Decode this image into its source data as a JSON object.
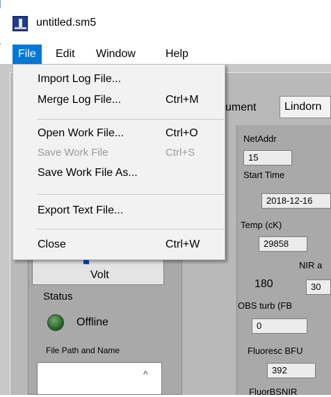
{
  "window": {
    "title": "untitled.sm5"
  },
  "menubar": {
    "items": [
      "File",
      "Edit",
      "Window",
      "Help"
    ]
  },
  "file_menu": {
    "items": [
      {
        "label": "Import Log File...",
        "shortcut": "",
        "enabled": true
      },
      {
        "label": "Merge Log File...",
        "shortcut": "Ctrl+M",
        "enabled": true
      },
      {
        "label": "Open Work File...",
        "shortcut": "Ctrl+O",
        "enabled": true
      },
      {
        "label": "Save Work File",
        "shortcut": "Ctrl+S",
        "enabled": false
      },
      {
        "label": "Save Work File As...",
        "shortcut": "",
        "enabled": true
      },
      {
        "label": "Export Text File...",
        "shortcut": "",
        "enabled": true
      },
      {
        "label": "Close",
        "shortcut": "Ctrl+W",
        "enabled": true
      }
    ]
  },
  "panel": {
    "instrument_label": "ument",
    "instrument_value": "Lindorn",
    "gauge_label": "Volt",
    "status_label": "Status",
    "status_value": "Offline",
    "file_path_label": "File Path and Name"
  },
  "fields": {
    "netaddr_label": "NetAddr",
    "netaddr_value": "15",
    "start_time_label": "Start Time",
    "start_time_value": "2018-12-16",
    "temp_label": "Temp (cK)",
    "temp_value": "29858",
    "nir_label": "NIR a",
    "nir_num": "180",
    "nir_value": "30",
    "obs_label": "OBS turb (FB",
    "obs_value": "0",
    "fluoresc_label": "Fluoresc BFU",
    "fluoresc_value": "392",
    "fluorbsnir_label": "FluorBSNIR"
  },
  "colors": {
    "menu_highlight": "#0078d7",
    "led": "#2e6b2f"
  }
}
